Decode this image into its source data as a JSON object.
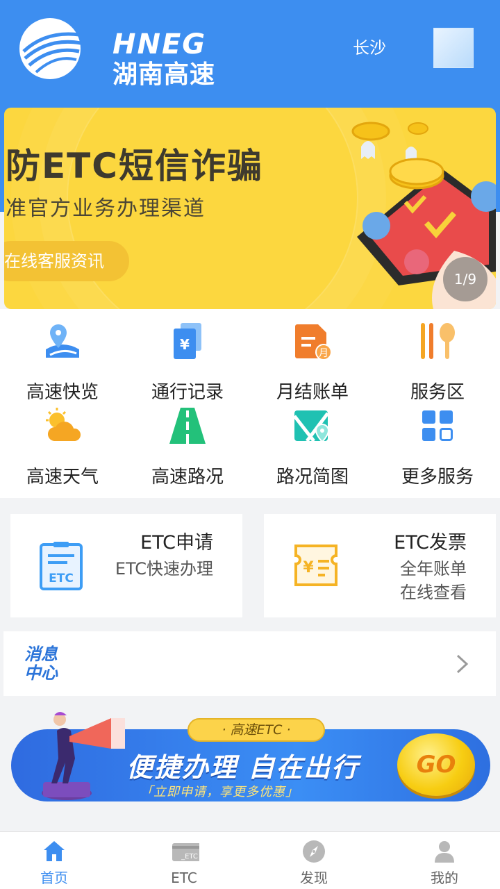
{
  "header": {
    "logo_en": "HNEG",
    "logo_cn": "湖南高速",
    "city": "长沙"
  },
  "banner": {
    "title": "谨防ETC短信诈骗",
    "subtitle": "认准官方业务办理渠道",
    "button": "在线客服资讯",
    "counter": "1/9"
  },
  "quick_menu": [
    {
      "label": "高速快览",
      "icon": "map-pin-road-icon"
    },
    {
      "label": "通行记录",
      "icon": "yuan-document-icon"
    },
    {
      "label": "月结账单",
      "icon": "monthly-bill-icon"
    },
    {
      "label": "服务区",
      "icon": "fork-spoon-icon"
    },
    {
      "label": "高速天气",
      "icon": "sun-cloud-icon"
    },
    {
      "label": "高速路况",
      "icon": "road-icon"
    },
    {
      "label": "路况简图",
      "icon": "map-location-icon"
    },
    {
      "label": "更多服务",
      "icon": "grid-icon"
    }
  ],
  "cards": {
    "etc_apply": {
      "title": "ETC申请",
      "desc": "ETC快速办理",
      "icon": "etc-card-icon"
    },
    "etc_invoice": {
      "title": "ETC发票",
      "desc_line1": "全年账单",
      "desc_line2": "在线查看",
      "icon": "invoice-icon"
    }
  },
  "message_center": {
    "label_line1": "消息",
    "label_line2": "中心"
  },
  "promo": {
    "badge": "· 高速ETC ·",
    "main": "便捷办理 自在出行",
    "sub": "「立即申请，享更多优惠」",
    "go": "GO"
  },
  "tabbar": [
    {
      "label": "首页",
      "icon": "home-icon",
      "active": true
    },
    {
      "label": "ETC",
      "icon": "etc-icon",
      "active": false
    },
    {
      "label": "发现",
      "icon": "compass-icon",
      "active": false
    },
    {
      "label": "我的",
      "icon": "user-icon",
      "active": false
    }
  ],
  "colors": {
    "primary": "#3d8ef0",
    "banner_bg": "#fcd73f",
    "background": "#f2f3f5"
  }
}
